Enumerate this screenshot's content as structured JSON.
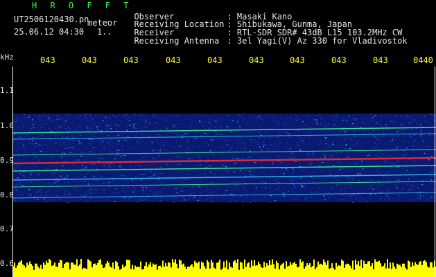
{
  "header": {
    "brand": "H R O F F T",
    "filename": "UT2506120430.pn",
    "filename_suffix": "meteor",
    "datetime": "25.06.12 04:30",
    "datetime_suffix": "1..",
    "info": [
      {
        "label": "Observer",
        "value": ": Masaki Kano"
      },
      {
        "label": "Receiving Location",
        "value": ": Shibukawa, Gunma, Japan"
      },
      {
        "label": "Receiver",
        "value": ": RTL-SDR SDR# 43dB L15 103.2MHz CW"
      },
      {
        "label": "Receiving Antenna",
        "value": ": 3el Yagi(V) Az 330 for Vladivostok"
      }
    ]
  },
  "axis": {
    "unit": "kHz",
    "time_ticks": [
      "043",
      "043",
      "043",
      "043",
      "043",
      "043",
      "043",
      "043",
      "043",
      "0440"
    ],
    "freq_ticks": [
      "1.1",
      "1.0",
      "0.9",
      "0.8",
      "0.7",
      "0.6"
    ]
  },
  "colors": {
    "background": "#000000",
    "text": "#e6e6e6",
    "tick_text": "#ffff33",
    "brand": "#3cff3c",
    "signal_noise": "#2040c0",
    "echo_line": "#ff3030",
    "amplitude_bar": "#ffff00"
  }
}
